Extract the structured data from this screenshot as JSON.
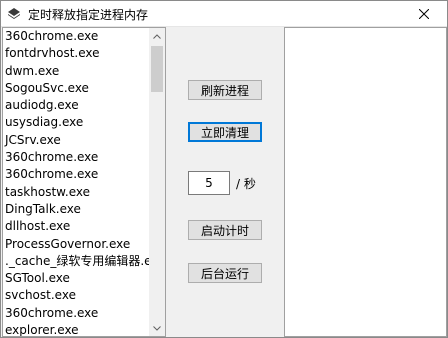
{
  "window": {
    "title": "定时释放指定进程内存",
    "icon": "app-icon",
    "close_icon": "close-icon"
  },
  "process_list": {
    "items": [
      "360chrome.exe",
      "fontdrvhost.exe",
      "dwm.exe",
      "SogouSvc.exe",
      "audiodg.exe",
      "usysdiag.exe",
      "JCSrv.exe",
      "360chrome.exe",
      "360chrome.exe",
      "taskhostw.exe",
      "DingTalk.exe",
      "dllhost.exe",
      "ProcessGovernor.exe",
      "._cache_绿软专用编辑器.ex",
      "SGTool.exe",
      "svchost.exe",
      "360chrome.exe",
      "explorer.exe"
    ]
  },
  "buttons": {
    "refresh": "刷新进程",
    "clean_now": "立即清理",
    "start_timer": "启动计时",
    "background_run": "后台运行"
  },
  "interval": {
    "value": "5",
    "unit": "/ 秒"
  }
}
